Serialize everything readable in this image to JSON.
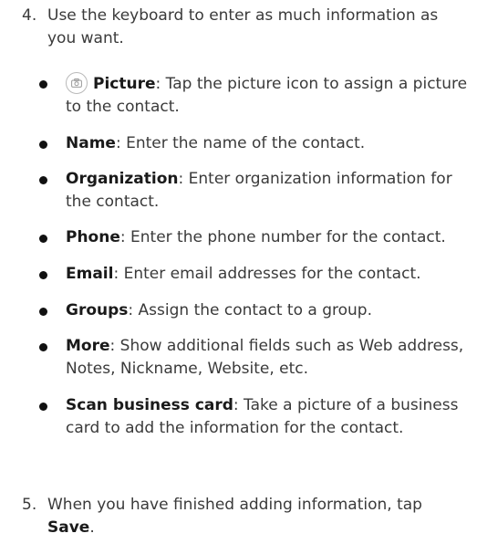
{
  "steps": [
    {
      "number": "4.",
      "text": "Use the keyboard to enter as much information as you want."
    },
    {
      "number": "5.",
      "text_before": "When you have finished adding information, tap ",
      "action": "Save",
      "text_after": "."
    }
  ],
  "bullets": [
    {
      "icon": "camera-icon",
      "term": "Picture",
      "desc": ": Tap the picture icon to assign a picture to the contact."
    },
    {
      "term": "Name",
      "desc": ": Enter the name of the contact."
    },
    {
      "term": "Organization",
      "desc": ": Enter organization information for the contact."
    },
    {
      "term": "Phone",
      "desc": ": Enter the phone number for the contact."
    },
    {
      "term": "Email",
      "desc": ": Enter email addresses for the contact."
    },
    {
      "term": "Groups",
      "desc": ": Assign the contact to a group."
    },
    {
      "term": "More",
      "desc": ": Show additional fields such as Web address, Notes, Nickname, Website, etc."
    },
    {
      "term": "Scan business card",
      "desc": ": Take a picture of a business card to add the information for the contact."
    }
  ]
}
